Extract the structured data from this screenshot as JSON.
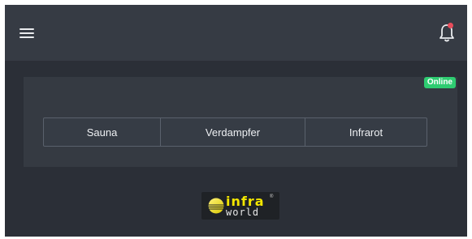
{
  "header": {
    "menu_icon": "hamburger-menu-icon",
    "bell_icon": "bell-icon",
    "notification_dot_color": "#e74c5b"
  },
  "status": {
    "label": "Online",
    "color": "#2ecc71"
  },
  "modes": [
    {
      "label": "Sauna"
    },
    {
      "label": "Verdampfer"
    },
    {
      "label": "Infrarot"
    }
  ],
  "logo": {
    "top_text": "infra",
    "bottom_text": "world",
    "registered_mark": "®"
  }
}
